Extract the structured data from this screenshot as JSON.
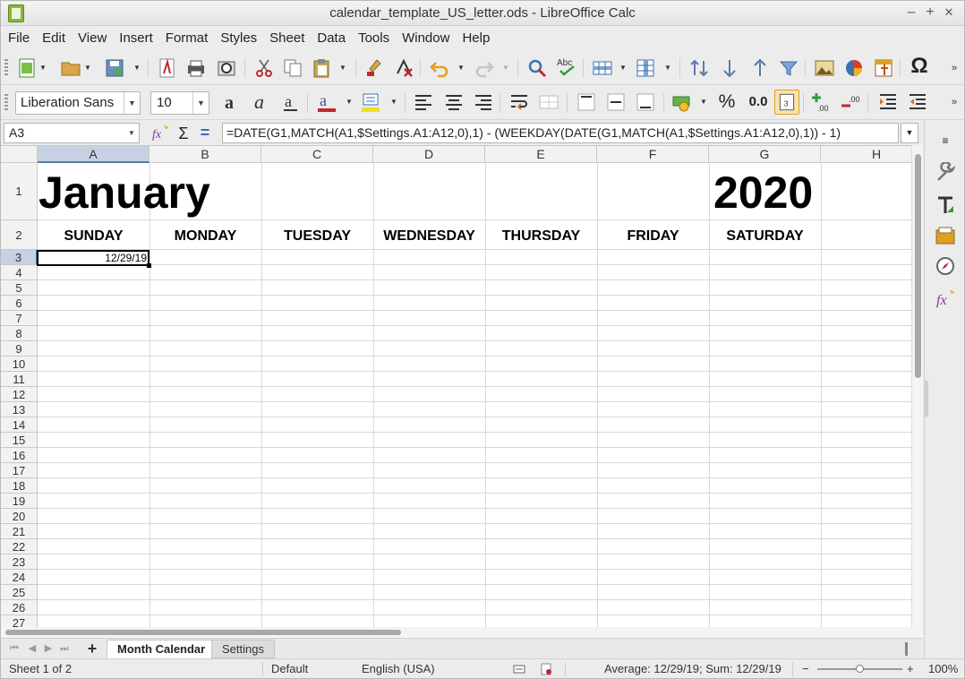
{
  "window": {
    "title": "calendar_template_US_letter.ods - LibreOffice Calc",
    "minimize": "–",
    "maximize": "+",
    "close": "✕"
  },
  "menu": [
    "File",
    "Edit",
    "View",
    "Insert",
    "Format",
    "Styles",
    "Sheet",
    "Data",
    "Tools",
    "Window",
    "Help"
  ],
  "format_toolbar": {
    "font_name": "Liberation Sans",
    "font_size": "10",
    "percent_label": "%",
    "number_label": "0.0"
  },
  "formula_bar": {
    "cell_ref": "A3",
    "formula": "=DATE(G1,MATCH(A1,$Settings.A1:A12,0),1) - (WEEKDAY(DATE(G1,MATCH(A1,$Settings.A1:A12,0),1)) - 1)",
    "sum_icon": "Σ",
    "equals_icon": "="
  },
  "sheet": {
    "columns": [
      "A",
      "B",
      "C",
      "D",
      "E",
      "F",
      "G",
      "H"
    ],
    "selected_column": "A",
    "rows": [
      "1",
      "2",
      "3",
      "4",
      "5",
      "6",
      "7",
      "8",
      "9",
      "10",
      "11",
      "12",
      "13",
      "14",
      "15",
      "16",
      "17",
      "18",
      "19",
      "20",
      "21",
      "22",
      "23",
      "24",
      "25",
      "26",
      "27"
    ],
    "selected_row": "3",
    "month": "January",
    "year": "2020",
    "days": [
      "SUNDAY",
      "MONDAY",
      "TUESDAY",
      "WEDNESDAY",
      "THURSDAY",
      "FRIDAY",
      "SATURDAY"
    ],
    "a3_value": "12/29/19"
  },
  "tabs": {
    "items": [
      {
        "label": "Month Calendar",
        "active": true
      },
      {
        "label": "Settings",
        "active": false
      }
    ]
  },
  "status": {
    "sheet_info": "Sheet 1 of 2",
    "page_style": "Default",
    "language": "English (USA)",
    "summary": "Average: 12/29/19; Sum: 12/29/19",
    "zoom_minus": "−",
    "zoom_plus": "+",
    "zoom": "100%",
    "zoom_fraction": 0.5
  },
  "colors": {
    "selection_header": "#c6d2e3",
    "accent": "#5a7aa8"
  }
}
